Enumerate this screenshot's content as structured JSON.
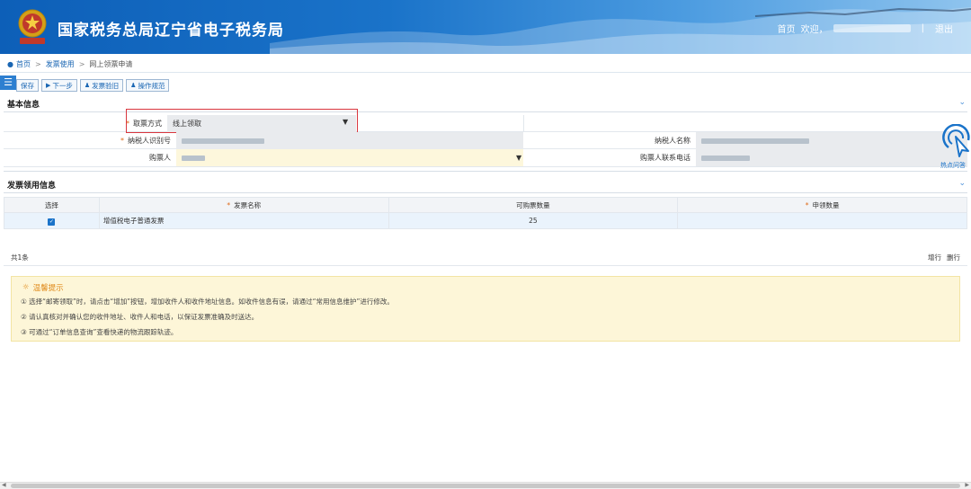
{
  "header": {
    "title": "国家税务总局辽宁省电子税务局",
    "nav_home": "首页",
    "nav_welcome": "欢迎，",
    "nav_separator": "|",
    "nav_logout": "退出"
  },
  "breadcrumb": {
    "home": "首页",
    "level1": "发票使用",
    "current": "网上领票申请"
  },
  "toolbar": {
    "save": "保存",
    "next": "下一步",
    "return_invoice": "发票验旧",
    "guide": "操作规范"
  },
  "basic_info": {
    "title": "基本信息",
    "pickup_label": "取票方式",
    "pickup_value": "线上领取",
    "taxpayer_id_label": "纳税人识别号",
    "taxpayer_name_label": "纳税人名称",
    "buyer_label": "购票人",
    "buyer_phone_label": "购票人联系电话"
  },
  "invoice_section": {
    "title": "发票领用信息",
    "columns": [
      "选择",
      "发票名称",
      "可购票数量",
      "申领数量"
    ],
    "rows": [
      {
        "checked": true,
        "name": "增值税电子普通发票",
        "available": "25",
        "apply": ""
      }
    ],
    "total": "共1条",
    "add_row": "增行",
    "delete_row": "删行"
  },
  "tips": {
    "title": "温馨提示",
    "items": [
      "① 选择“邮寄领取”时，请点击“增加”按钮，增加收件人和收件地址信息。如收件信息有误，请通过“常用信息维护”进行修改。",
      "② 请认真核对并确认您的收件地址、收件人和电话，以保证发票准确及时送达。",
      "③ 可通过“订单信息查询”查看快递的物流跟踪轨迹。"
    ]
  },
  "assist": {
    "label": "热点问答"
  },
  "colors": {
    "brand_blue": "#1a73c9",
    "required": "#e06b1a",
    "highlight_border": "#d9363e"
  }
}
